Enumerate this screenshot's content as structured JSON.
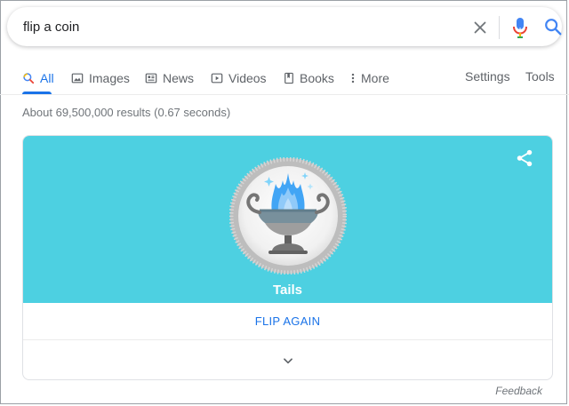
{
  "search": {
    "query": "flip a coin",
    "icons": {
      "clear": "close-icon",
      "voice": "microphone-icon",
      "submit": "search-icon"
    }
  },
  "tabs": [
    {
      "label": "All",
      "icon": "search-icon",
      "active": true
    },
    {
      "label": "Images",
      "icon": "image-icon"
    },
    {
      "label": "News",
      "icon": "newspaper-icon"
    },
    {
      "label": "Videos",
      "icon": "play-icon"
    },
    {
      "label": "Books",
      "icon": "book-icon"
    },
    {
      "label": "More",
      "icon": "more-vertical-icon"
    }
  ],
  "tools": {
    "settings": "Settings",
    "tools": "Tools"
  },
  "stats": "About 69,500,000 results (0.67 seconds)",
  "coin_card": {
    "result": "Tails",
    "flip_again": "FLIP AGAIN",
    "icons": {
      "share": "share-icon",
      "expand": "chevron-down-icon",
      "coin": "coin-tails-brazier-icon"
    },
    "colors": {
      "background": "#4dd0e1",
      "flame": "#42a5f5",
      "accent": "#1a73e8"
    }
  },
  "feedback": "Feedback"
}
